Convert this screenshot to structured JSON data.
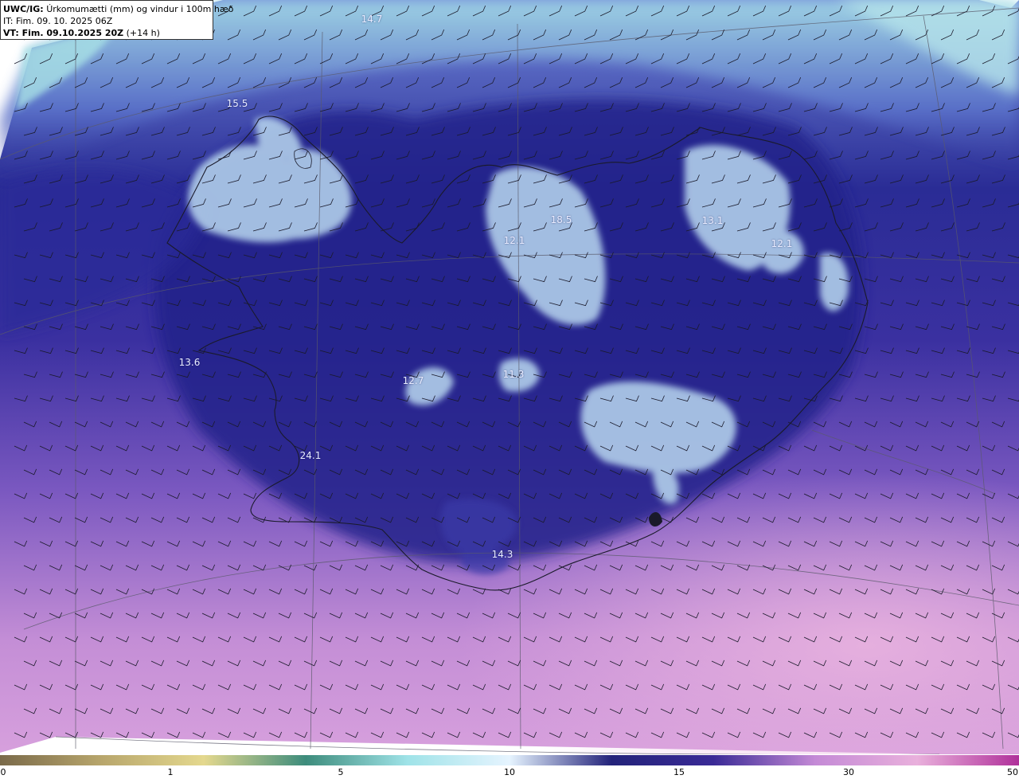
{
  "header": {
    "model_tag": "UWC/IG:",
    "title": "Úrkomumætti (mm) og vindur i 100m hæð",
    "init_time": "IT: Fim. 09. 10. 2025 06Z",
    "valid_prefix": "VT: Fim. 09.10.2025 20Z",
    "valid_suffix": "(+14 h)"
  },
  "values": [
    {
      "text": "14.7"
    },
    {
      "text": "15.5"
    },
    {
      "text": "18.5"
    },
    {
      "text": "12.1"
    },
    {
      "text": "13.1"
    },
    {
      "text": "12.1"
    },
    {
      "text": "13.6"
    },
    {
      "text": "12.7"
    },
    {
      "text": "11.3"
    },
    {
      "text": "24.1"
    },
    {
      "text": "14.3"
    }
  ],
  "colorbar": {
    "ticks": [
      "0",
      "1",
      "5",
      "10",
      "15",
      "30",
      "50"
    ],
    "colors": [
      "#7a6a4a",
      "#b8a66c",
      "#e4d88e",
      "#3d8c7c",
      "#9fe3e8",
      "#e6f4ff",
      "#23237a",
      "#3a2a96",
      "#c48ad6",
      "#e9b0dc",
      "#b0309a"
    ]
  },
  "map_colors": {
    "sea_light": "#9edbe3",
    "moisture_high": "#22238a",
    "moisture_low": "#d79ad8"
  }
}
